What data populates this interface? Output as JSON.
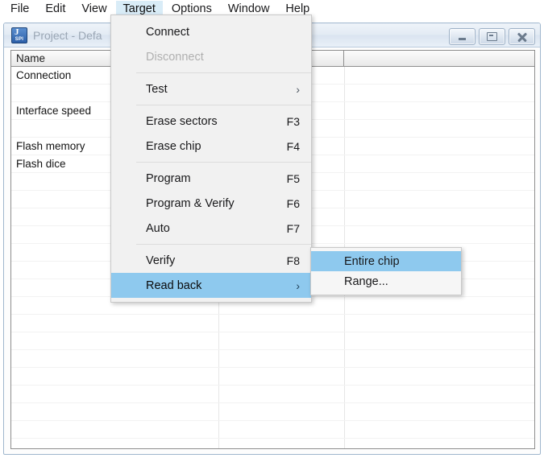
{
  "menubar": {
    "items": [
      {
        "label": "File",
        "active": false
      },
      {
        "label": "Edit",
        "active": false
      },
      {
        "label": "View",
        "active": false
      },
      {
        "label": "Target",
        "active": true
      },
      {
        "label": "Options",
        "active": false
      },
      {
        "label": "Window",
        "active": false
      },
      {
        "label": "Help",
        "active": false
      }
    ]
  },
  "window": {
    "title": "Project - Defa",
    "icon_top": "J",
    "icon_bottom": "SPI",
    "buttons": {
      "minimize": "minimize-button",
      "restore": "restore-button",
      "close": "close-button"
    }
  },
  "grid": {
    "columns": [
      "Name",
      "",
      ""
    ],
    "rows": [
      "Connection",
      "",
      "Interface speed",
      "",
      "Flash memory",
      "Flash dice",
      "",
      "",
      "",
      "",
      "",
      "",
      "",
      "",
      "",
      "",
      "",
      "",
      "",
      "",
      "",
      ""
    ]
  },
  "target_menu": {
    "items": [
      {
        "label": "Connect",
        "accel": "",
        "state": "normal",
        "arrow": false
      },
      {
        "label": "Disconnect",
        "accel": "",
        "state": "disabled",
        "arrow": false
      },
      {
        "separator": true
      },
      {
        "label": "Test",
        "accel": "",
        "state": "normal",
        "arrow": true
      },
      {
        "separator": true
      },
      {
        "label": "Erase sectors",
        "accel": "F3",
        "state": "normal",
        "arrow": false
      },
      {
        "label": "Erase chip",
        "accel": "F4",
        "state": "normal",
        "arrow": false
      },
      {
        "separator": true
      },
      {
        "label": "Program",
        "accel": "F5",
        "state": "normal",
        "arrow": false
      },
      {
        "label": "Program & Verify",
        "accel": "F6",
        "state": "normal",
        "arrow": false
      },
      {
        "label": "Auto",
        "accel": "F7",
        "state": "normal",
        "arrow": false
      },
      {
        "separator": true
      },
      {
        "label": "Verify",
        "accel": "F8",
        "state": "normal",
        "arrow": false
      },
      {
        "label": "Read back",
        "accel": "",
        "state": "selected",
        "arrow": true
      }
    ]
  },
  "readback_submenu": {
    "items": [
      {
        "label": "Entire chip",
        "state": "selected"
      },
      {
        "label": "Range...",
        "state": "normal"
      }
    ]
  },
  "colors": {
    "menu_highlight": "#8ec9ee",
    "menubar_highlight": "#d9ecf7",
    "menu_bg": "#f1f1f1",
    "submenu_bg": "#f6f6f6",
    "disabled_text": "#b0b0b0",
    "titlebar_text": "#9aa6b4"
  },
  "glyphs": {
    "submenu_arrow": "›"
  }
}
